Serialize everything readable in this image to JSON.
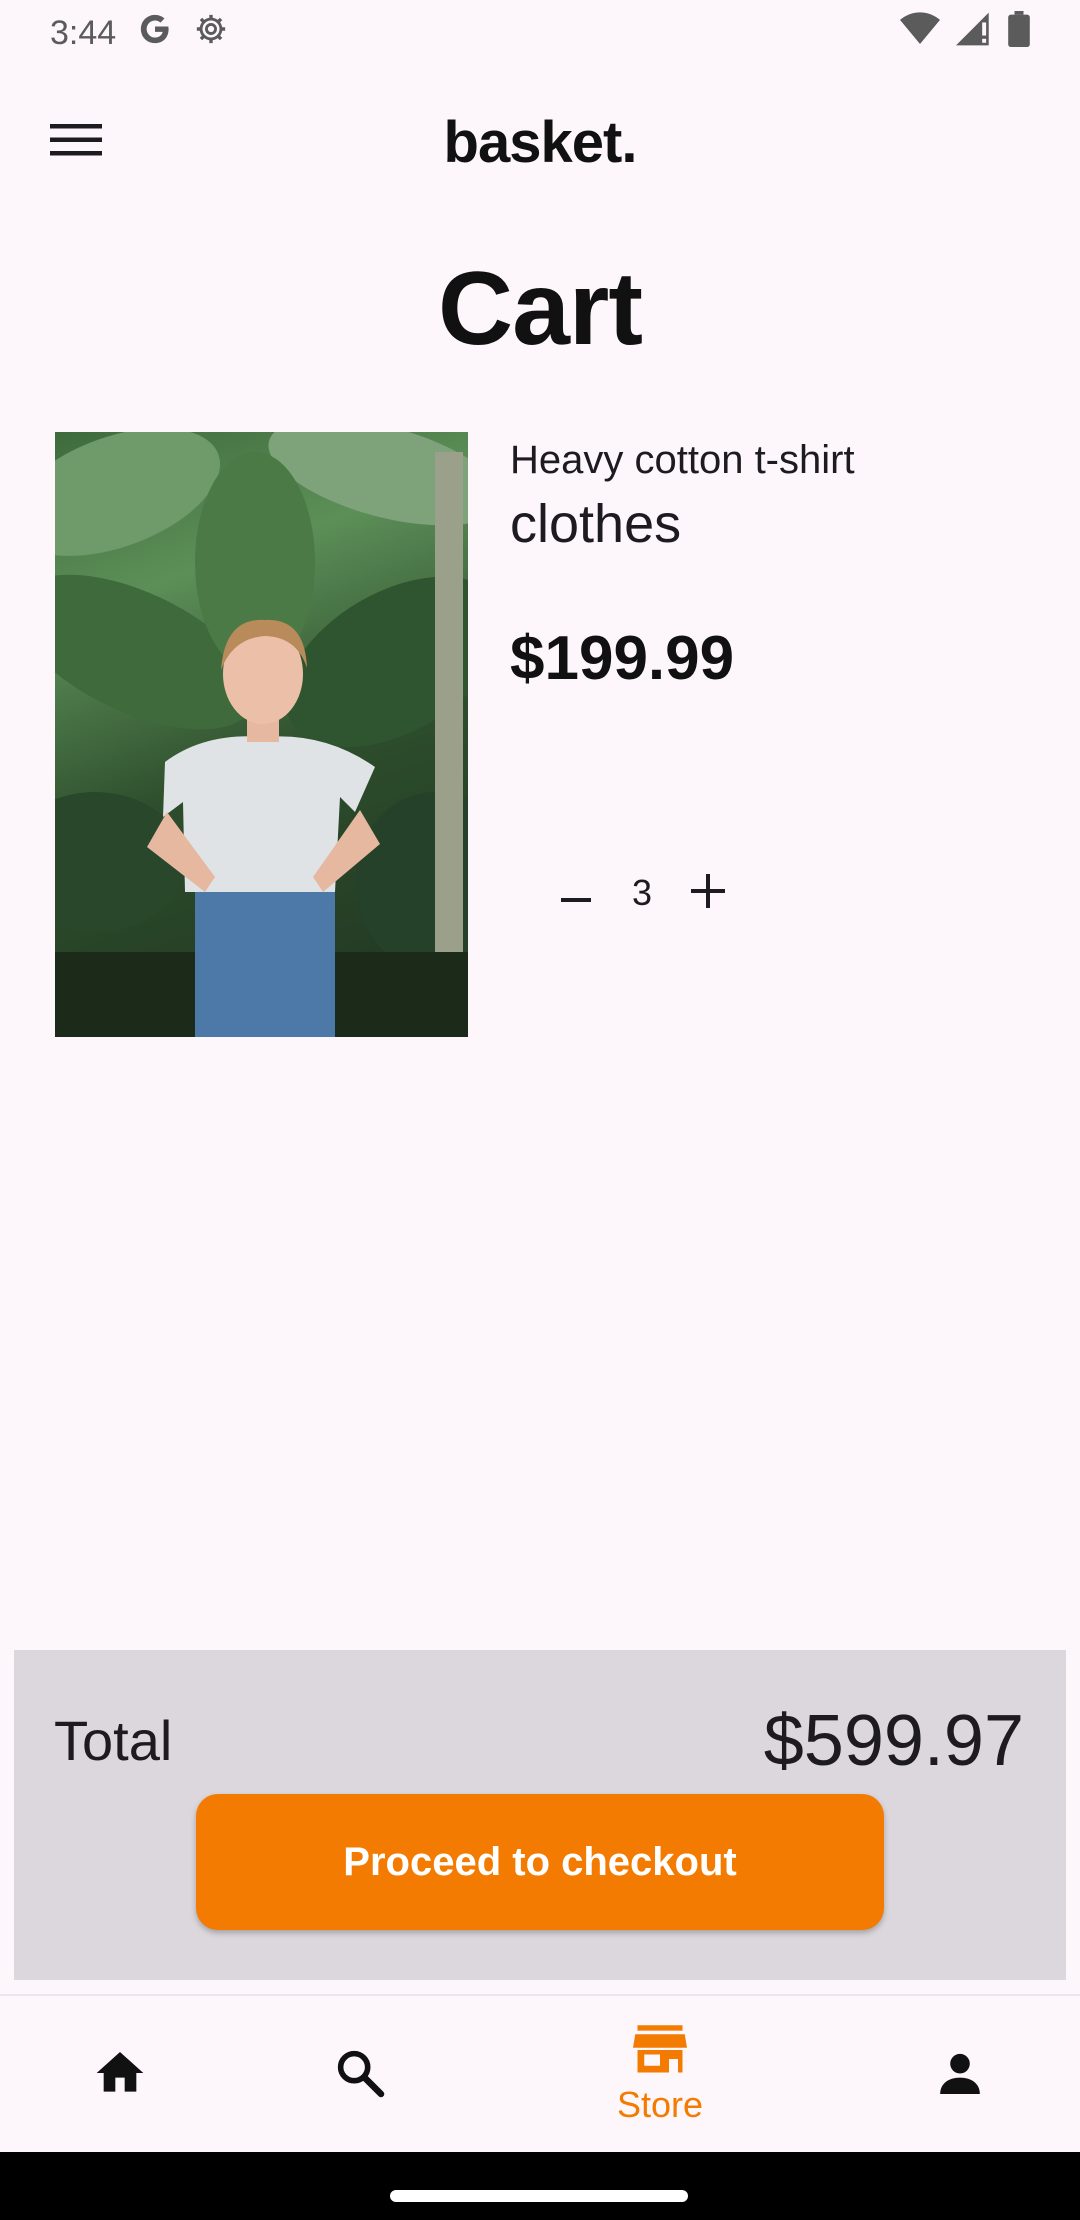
{
  "status_bar": {
    "time": "3:44",
    "left_icons": [
      "google-icon",
      "settings-gear-icon"
    ],
    "right_icons": [
      "wifi-icon",
      "cell-signal-icon",
      "battery-icon"
    ]
  },
  "app_bar": {
    "brand": "basket.",
    "menu_icon": "hamburger-menu-icon"
  },
  "page": {
    "title": "Cart"
  },
  "cart": {
    "items": [
      {
        "name": "Heavy cotton t-shirt",
        "category": "clothes",
        "price": "$199.99",
        "quantity": "3",
        "image": "woman-in-white-tshirt-among-plants"
      }
    ]
  },
  "summary": {
    "total_label": "Total",
    "total_value": "$599.97",
    "checkout_label": "Proceed to checkout"
  },
  "bottom_nav": {
    "items": [
      {
        "icon": "home-icon",
        "label": ""
      },
      {
        "icon": "search-icon",
        "label": ""
      },
      {
        "icon": "store-icon",
        "label": "Store",
        "active": true
      },
      {
        "icon": "person-icon",
        "label": ""
      }
    ]
  },
  "colors": {
    "accent": "#f47b02",
    "background": "#fdf7fc",
    "summary_panel": "#dcd7dc"
  }
}
